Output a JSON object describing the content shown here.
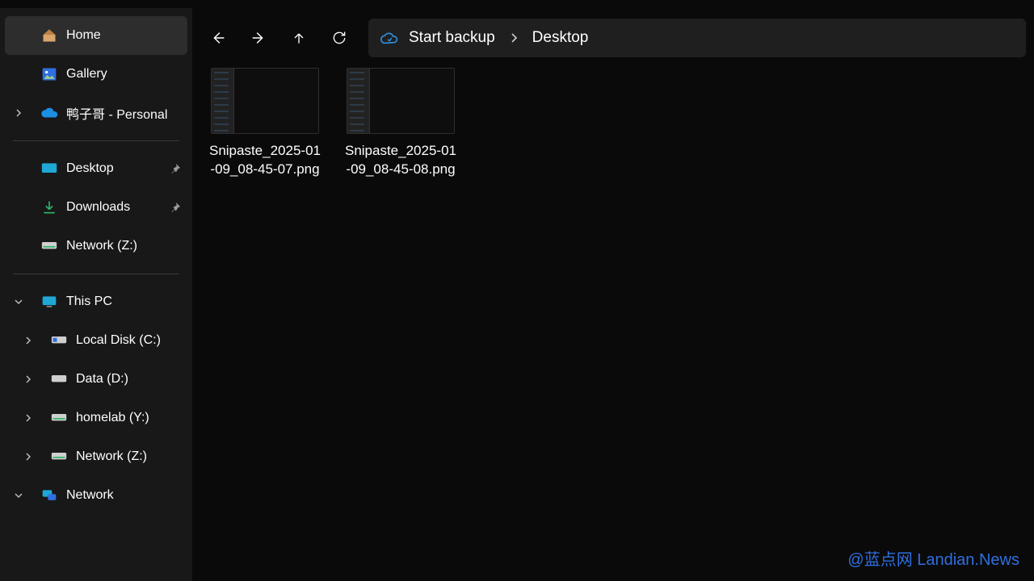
{
  "sidebar": {
    "home": "Home",
    "gallery": "Gallery",
    "onedrive": "鸭子哥 - Personal",
    "quick": {
      "desktop": "Desktop",
      "downloads": "Downloads",
      "network_z": "Network (Z:)"
    },
    "thispc": {
      "label": "This PC",
      "local_c": "Local Disk (C:)",
      "data_d": "Data (D:)",
      "homelab_y": "homelab (Y:)",
      "network_z": "Network (Z:)"
    },
    "network": "Network"
  },
  "toolbar": {
    "start_backup": "Start backup",
    "crumb_desktop": "Desktop"
  },
  "files": [
    {
      "name": "Snipaste_2025-01-09_08-45-07.png"
    },
    {
      "name": "Snipaste_2025-01-09_08-45-08.png"
    }
  ],
  "watermark": "@蓝点网 Landian.News"
}
